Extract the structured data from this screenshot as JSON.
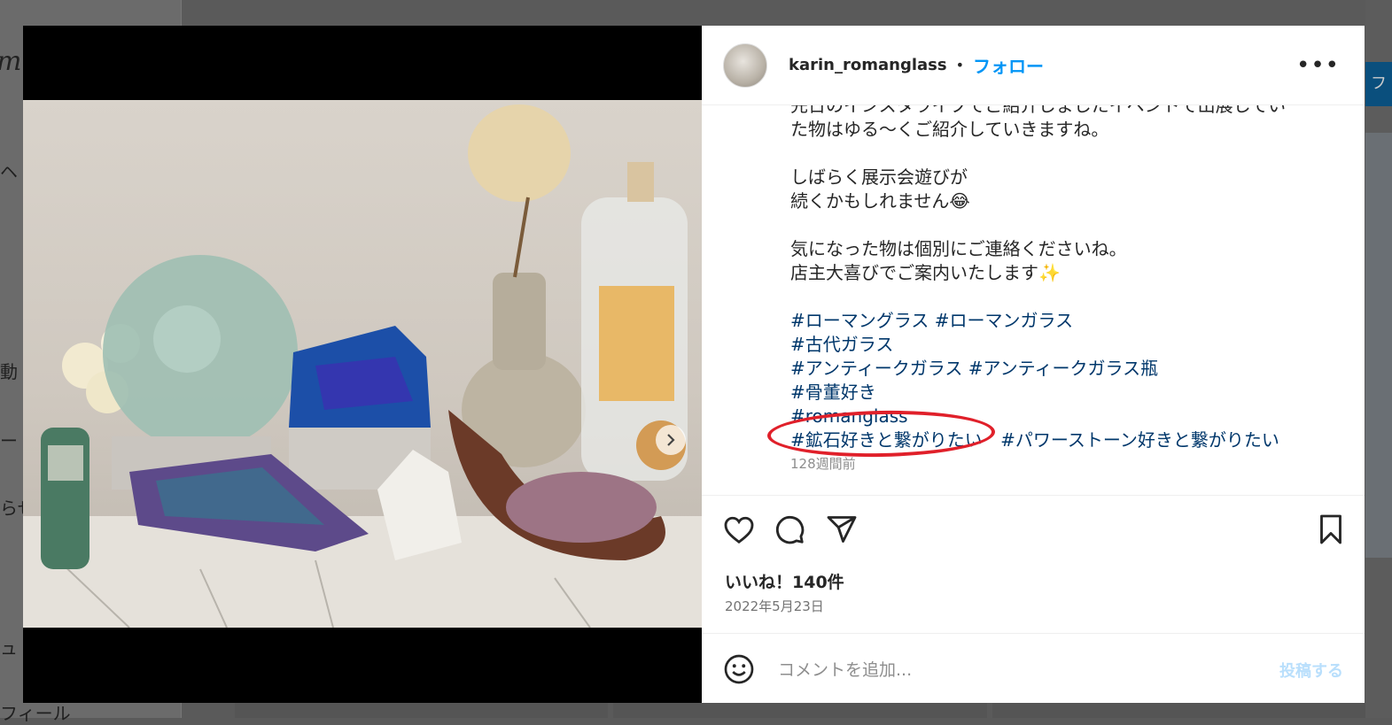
{
  "background": {
    "logo_fragment": "m",
    "nav_fragments": [
      "ヘ",
      "動",
      "ー",
      "らせ",
      "ュ",
      "フィール"
    ],
    "right_follow_fragment": "フォ"
  },
  "post": {
    "username": "karin_romanglass",
    "separator": "•",
    "follow_label": "フォロー",
    "more_icon": "more-options-icon",
    "caption_lines": [
      "先日のインスタライブでご紹介しましたイベントで出展してい",
      "た物はゆる〜くご紹介していきますね。",
      "",
      "しばらく展示会遊びが",
      "続くかもしれません😂",
      "",
      "気になった物は個別にご連絡くださいね。",
      "店主大喜びでご案内いたします✨",
      ""
    ],
    "hashtag_lines": [
      [
        "#ローマングラス",
        "#ローマンガラス"
      ],
      [
        "#古代ガラス"
      ],
      [
        "#アンティークガラス",
        "#アンティークガラス瓶"
      ],
      [
        "#骨董好き"
      ],
      [
        "#romanglass"
      ],
      [
        "#鉱石好きと繋がりたい",
        "#パワーストーン好きと繋がりたい"
      ]
    ],
    "caption_time": "128週間前",
    "likes": "いいね！140件",
    "date": "2022年5月23日",
    "comment_placeholder": "コメントを追加...",
    "post_button": "投稿する",
    "hashtag_color": "#00376b",
    "follow_color": "#0095f6",
    "highlight_color": "#e0202a"
  },
  "carousel": {
    "total": 2,
    "active": 1
  }
}
